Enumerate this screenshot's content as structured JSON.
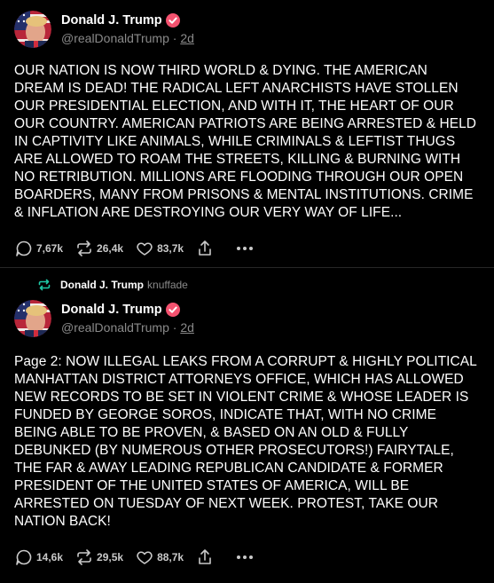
{
  "posts": [
    {
      "author": {
        "name": "Donald J. Trump",
        "handle": "@realDonaldTrump",
        "time": "2d"
      },
      "text": "OUR NATION IS NOW THIRD WORLD & DYING. THE AMERICAN DREAM IS DEAD! THE RADICAL LEFT ANARCHISTS HAVE STOLLEN  OUR PRESIDENTIAL ELECTION, AND WITH IT, THE HEART OF OUR OUR COUNTRY. AMERICAN PATRIOTS ARE BEING ARRESTED & HELD IN CAPTIVITY LIKE ANIMALS, WHILE CRIMINALS & LEFTIST THUGS ARE ALLOWED TO ROAM THE STREETS, KILLING & BURNING WITH NO RETRIBUTION. MILLIONS ARE FLOODING THROUGH OUR OPEN BOARDERS, MANY FROM PRISONS & MENTAL INSTITUTIONS. CRIME & INFLATION ARE DESTROYING OUR VERY WAY OF LIFE...",
      "stats": {
        "replies": "7,67k",
        "reposts": "26,4k",
        "likes": "83,7k"
      }
    },
    {
      "repost": {
        "name": "Donald J. Trump",
        "verb": "knuffade"
      },
      "author": {
        "name": "Donald J. Trump",
        "handle": "@realDonaldTrump",
        "time": "2d"
      },
      "text": "Page 2: NOW ILLEGAL LEAKS FROM A CORRUPT & HIGHLY POLITICAL MANHATTAN DISTRICT ATTORNEYS OFFICE, WHICH HAS ALLOWED NEW RECORDS TO BE SET IN VIOLENT CRIME & WHOSE LEADER IS FUNDED BY GEORGE SOROS, INDICATE THAT, WITH NO CRIME BEING ABLE TO BE PROVEN, & BASED ON AN OLD & FULLY DEBUNKED (BY NUMEROUS OTHER PROSECUTORS!) FAIRYTALE, THE FAR & AWAY LEADING REPUBLICAN CANDIDATE & FORMER PRESIDENT OF THE UNITED STATES OF AMERICA, WILL BE ARRESTED ON TUESDAY OF NEXT WEEK. PROTEST, TAKE OUR NATION BACK!",
      "stats": {
        "replies": "14,6k",
        "reposts": "29,5k",
        "likes": "88,7k"
      }
    }
  ],
  "colors": {
    "background": "#000000",
    "verified": "#f4526f",
    "repost_icon": "#1ec8a5",
    "muted": "#8a8a8a"
  },
  "icons": [
    "avatar",
    "verified-badge-icon",
    "repost-icon",
    "reply-icon",
    "like-icon",
    "share-icon",
    "more-icon"
  ]
}
